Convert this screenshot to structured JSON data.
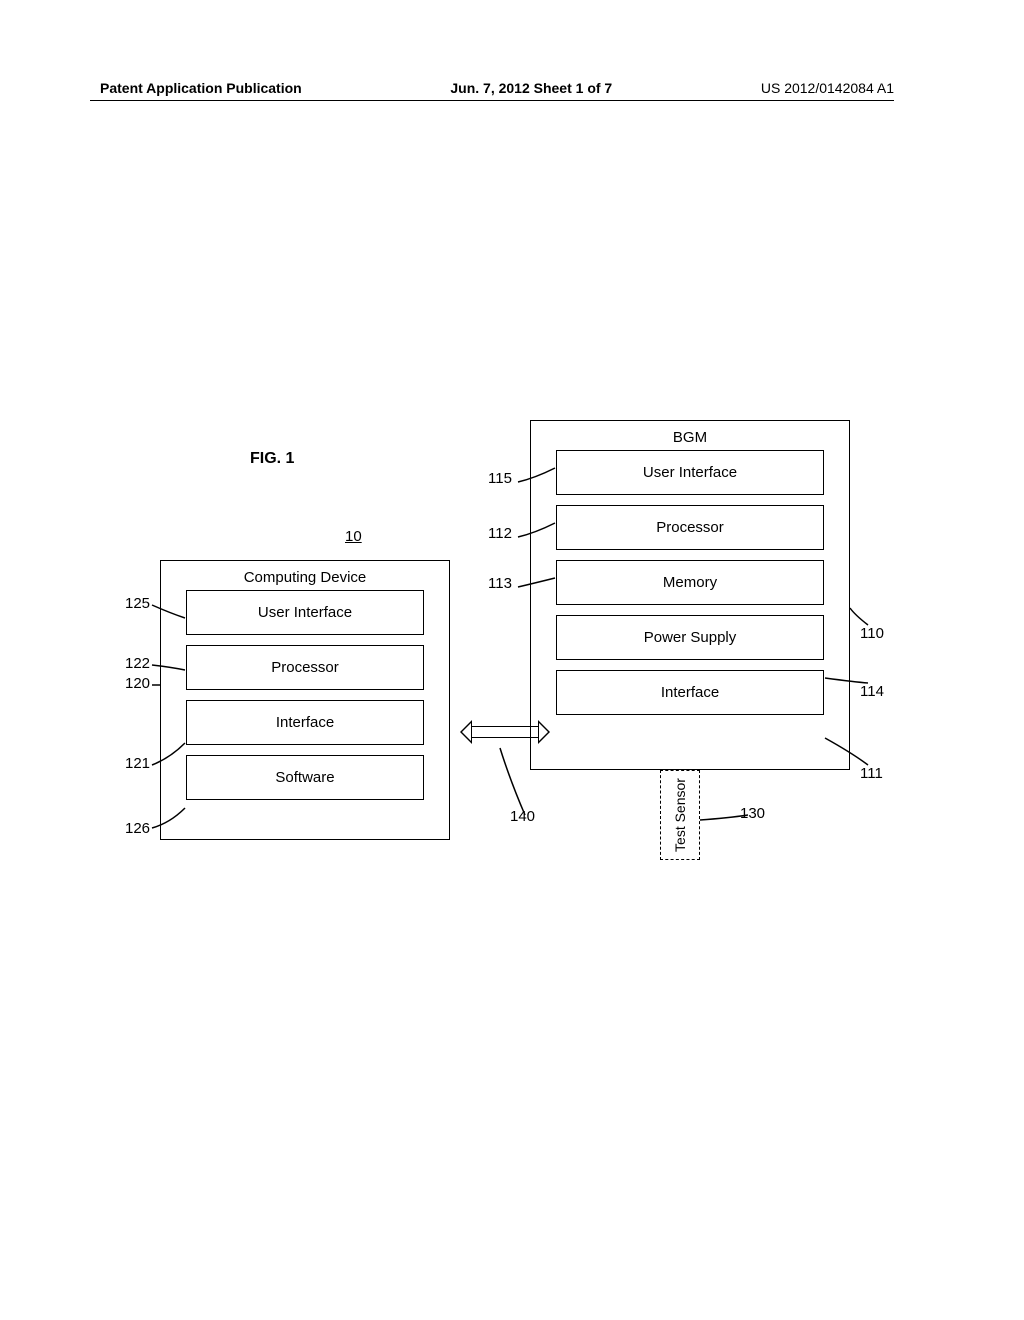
{
  "header": {
    "left": "Patent Application Publication",
    "center": "Jun. 7, 2012  Sheet 1 of 7",
    "right": "US 2012/0142084 A1"
  },
  "figure_label": "FIG. 1",
  "ref_10": "10",
  "bgm": {
    "title": "BGM",
    "user_interface": "User Interface",
    "processor": "Processor",
    "memory": "Memory",
    "power_supply": "Power Supply",
    "interface": "Interface"
  },
  "computing_device": {
    "title": "Computing Device",
    "user_interface": "User Interface",
    "processor": "Processor",
    "interface": "Interface",
    "software": "Software"
  },
  "test_sensor": "Test Sensor",
  "refs": {
    "r115": "115",
    "r112": "112",
    "r113": "113",
    "r110": "110",
    "r114": "114",
    "r111": "111",
    "r130": "130",
    "r125": "125",
    "r122": "122",
    "r120": "120",
    "r121": "121",
    "r126": "126",
    "r140": "140"
  }
}
